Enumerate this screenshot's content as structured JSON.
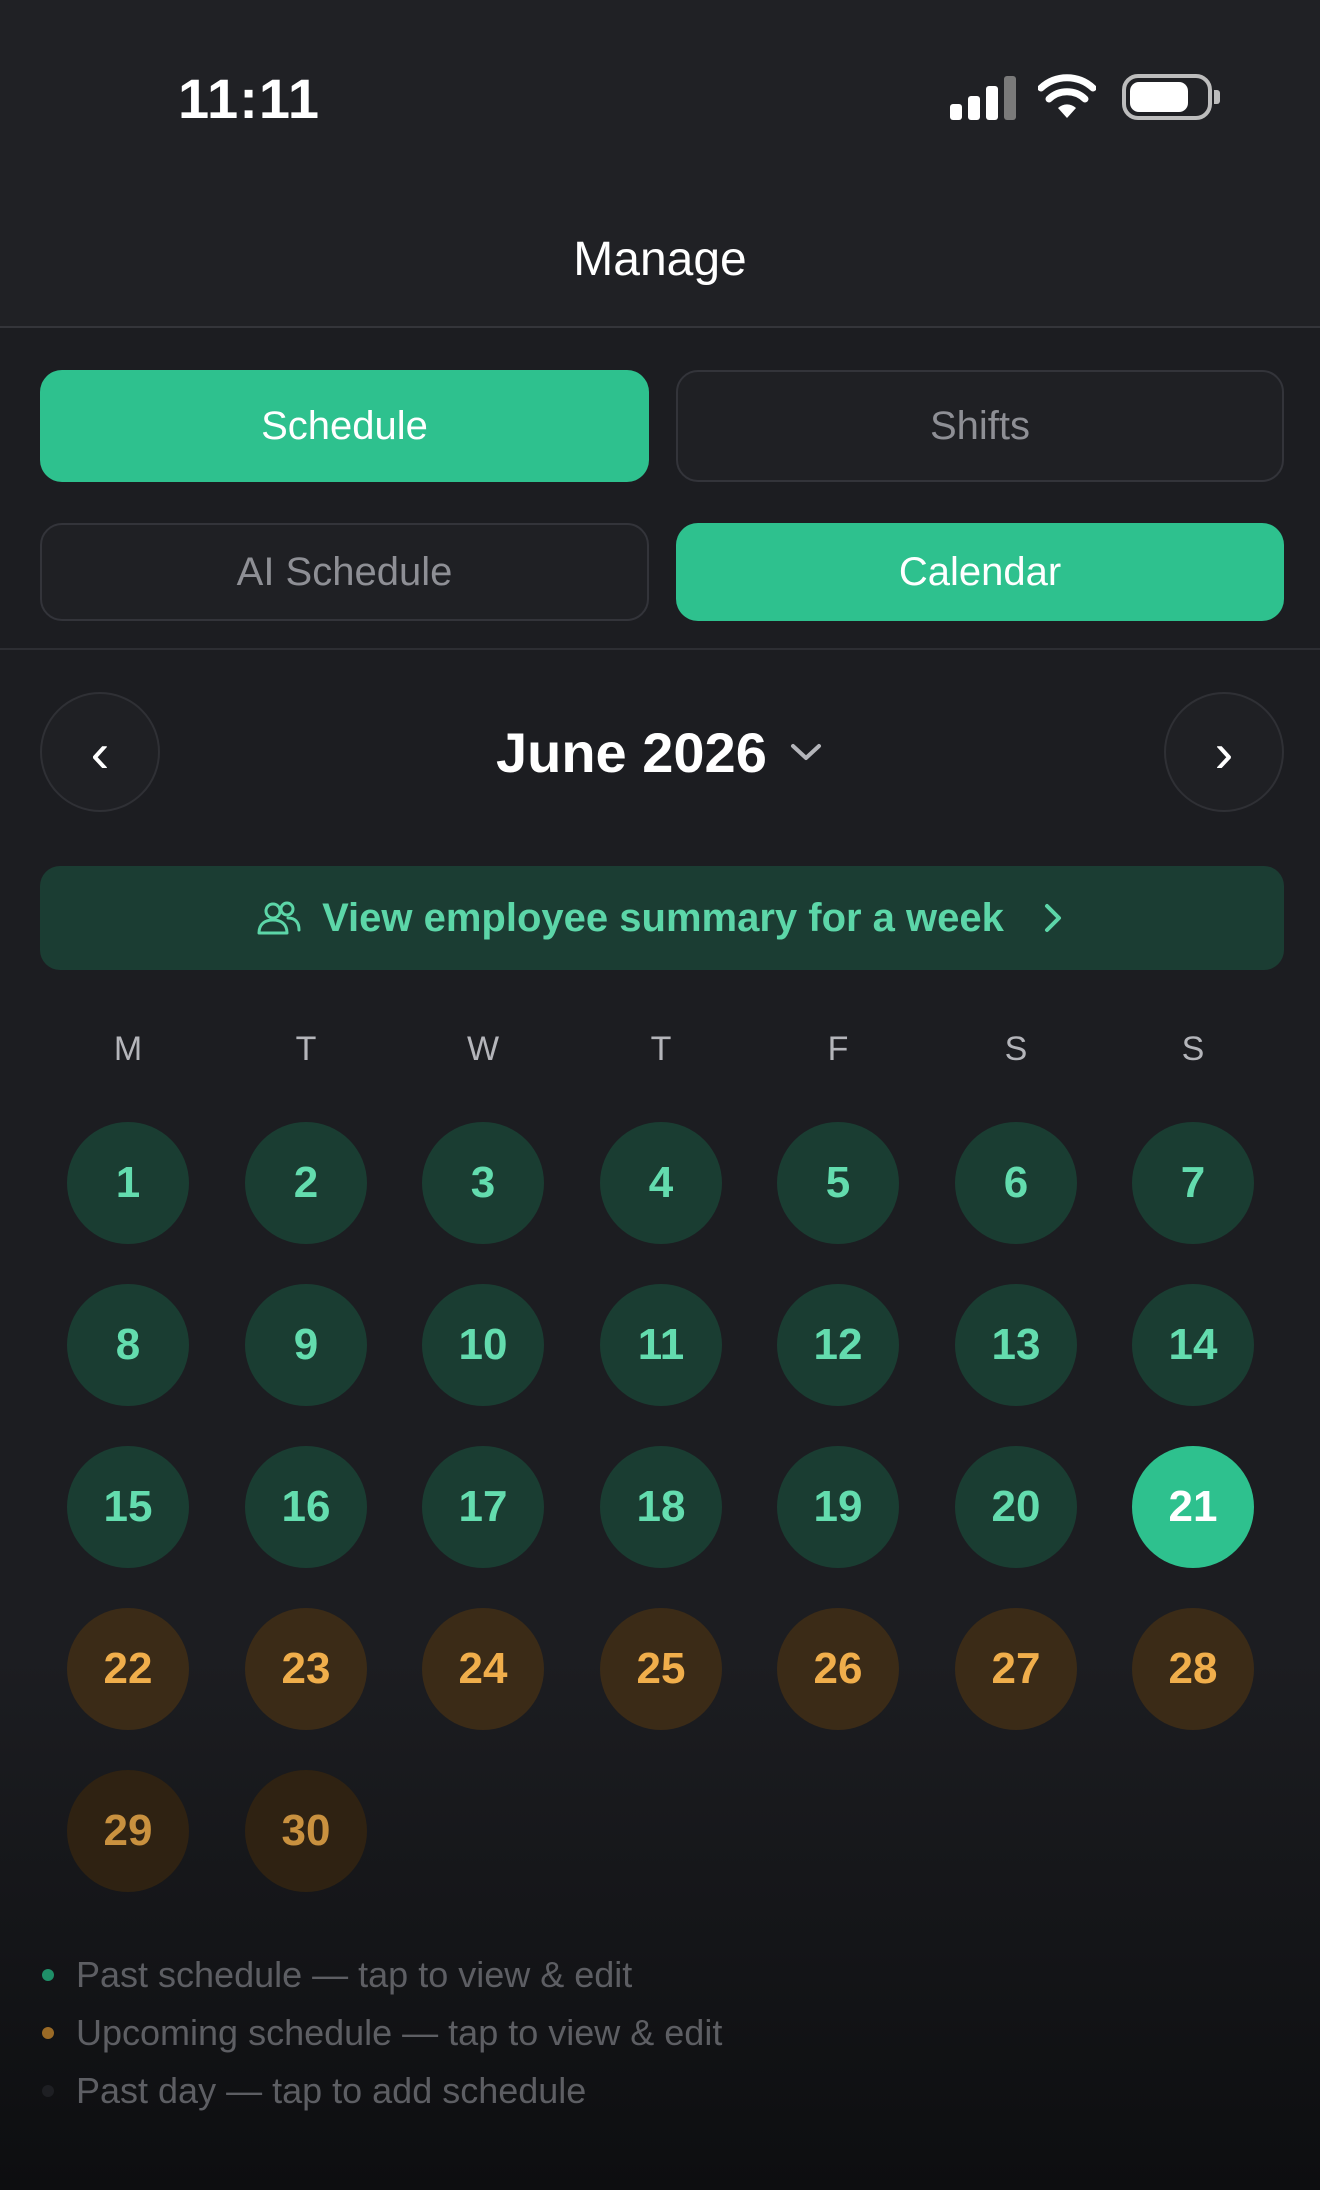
{
  "status_bar": {
    "time": "11:11"
  },
  "header": {
    "title": "Manage"
  },
  "tabs": {
    "schedule": "Schedule",
    "shifts": "Shifts",
    "ai_schedule": "AI Schedule",
    "calendar": "Calendar"
  },
  "calendar": {
    "prev_label": "‹",
    "next_label": "›",
    "month_label": "June 2026",
    "summary_label": "View employee summary for a week",
    "weekdays": [
      "M",
      "T",
      "W",
      "T",
      "F",
      "S",
      "S"
    ],
    "days": [
      "1",
      "2",
      "3",
      "4",
      "5",
      "6",
      "7",
      "8",
      "9",
      "10",
      "11",
      "12",
      "13",
      "14",
      "15",
      "16",
      "17",
      "18",
      "19",
      "20",
      "21",
      "22",
      "23",
      "24",
      "25",
      "26",
      "27",
      "28",
      "29",
      "30"
    ],
    "today": "21"
  },
  "legend": {
    "past_schedule": "Past schedule — tap to view & edit",
    "upcoming_schedule": "Upcoming schedule — tap to view & edit",
    "past_day": "Past day — tap to add schedule"
  },
  "colors": {
    "accent": "#2ec18e",
    "past": "#1a3d32",
    "upcoming": "#3b2b17",
    "upcoming_text": "#f0ae4b"
  }
}
